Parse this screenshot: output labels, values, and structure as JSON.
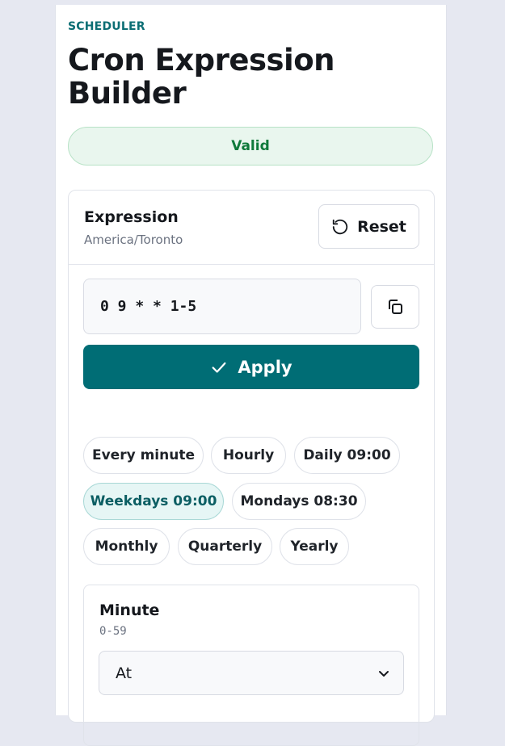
{
  "header": {
    "eyebrow": "SCHEDULER",
    "title": "Cron Expression Builder"
  },
  "status": {
    "label": "Valid",
    "color": "#0f7a3b"
  },
  "expression_card": {
    "title": "Expression",
    "timezone": "America/Toronto",
    "reset_label": "Reset",
    "expression_value": "0 9 * * 1-5",
    "apply_label": "Apply",
    "accent_color": "#006d75"
  },
  "presets": [
    {
      "label": "Every minute",
      "active": false
    },
    {
      "label": "Hourly",
      "active": false
    },
    {
      "label": "Daily 09:00",
      "active": false
    },
    {
      "label": "Weekdays 09:00",
      "active": true
    },
    {
      "label": "Mondays 08:30",
      "active": false
    },
    {
      "label": "Monthly",
      "active": false
    },
    {
      "label": "Quarterly",
      "active": false
    },
    {
      "label": "Yearly",
      "active": false
    }
  ],
  "minute_field": {
    "title": "Minute",
    "range": "0-59",
    "mode_selected": "At"
  },
  "icons": {
    "reset": "rotate-ccw-icon",
    "copy": "copy-icon",
    "apply": "check-icon",
    "select": "chevron-down-icon"
  }
}
